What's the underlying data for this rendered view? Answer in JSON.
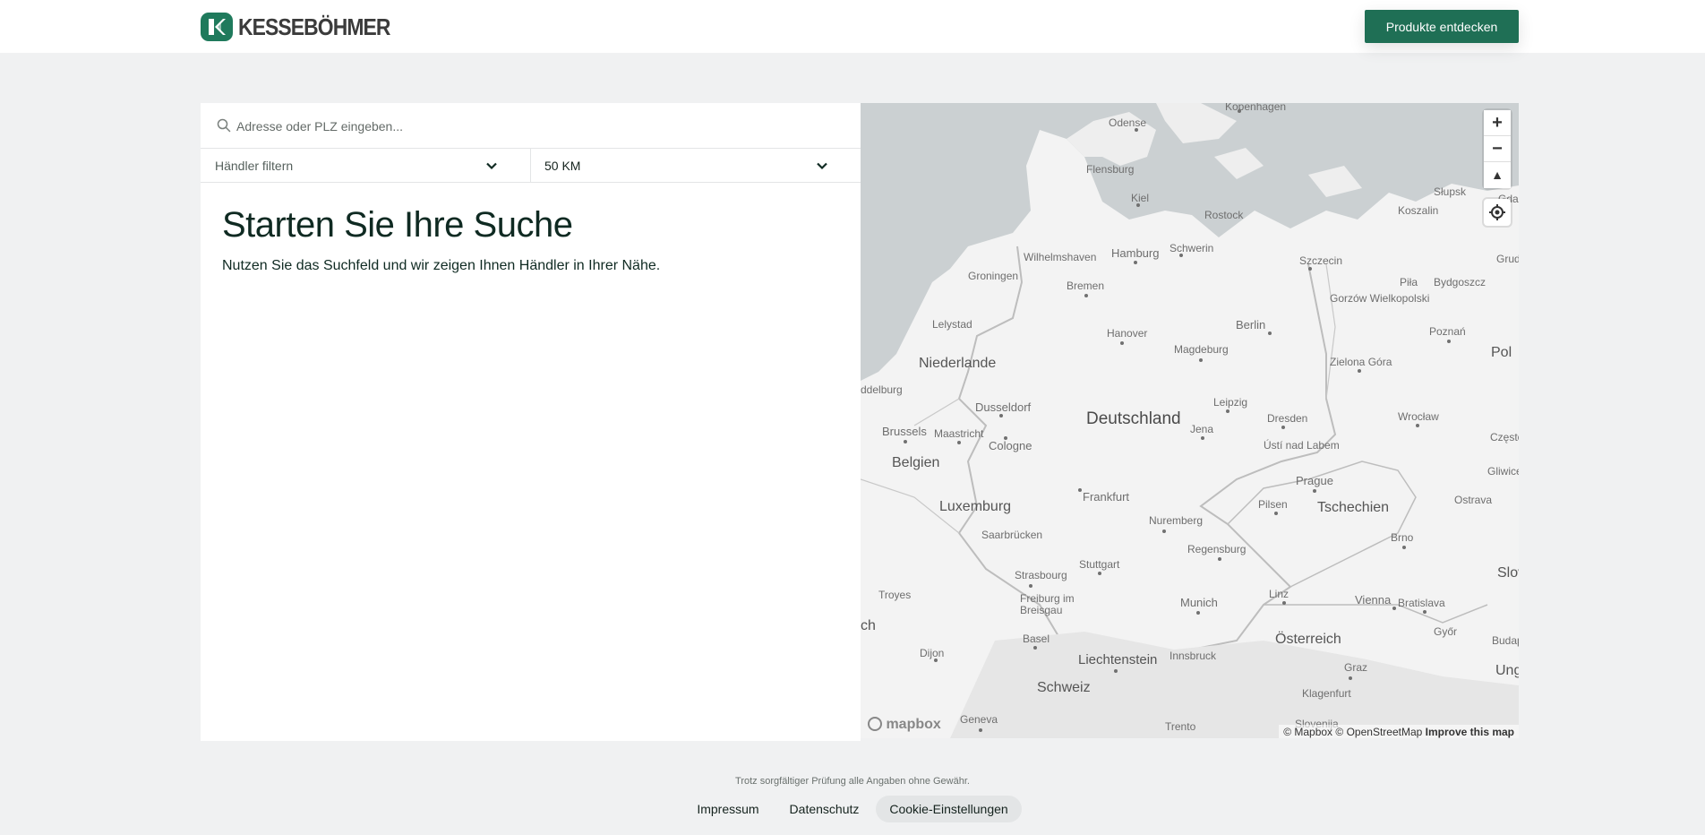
{
  "header": {
    "brand": "KESSEBÖHMER",
    "cta_label": "Produkte entdecken",
    "brand_color": "#1f7a5c"
  },
  "search": {
    "placeholder": "Adresse oder PLZ eingeben...",
    "icon": "search-icon"
  },
  "filters": {
    "dealer_label": "Händler filtern",
    "radius_value": "50 KM"
  },
  "main": {
    "heading": "Starten Sie Ihre Suche",
    "subtext": "Nutzen Sie das Suchfeld und wir zeigen Ihnen Händler in Ihrer Nähe."
  },
  "map": {
    "labels": {
      "kopenhagen": "Kopenhagen",
      "odense": "Odense",
      "flensburg": "Flensburg",
      "kiel": "Kiel",
      "rostock": "Rostock",
      "hamburg": "Hamburg",
      "schwerin": "Schwerin",
      "szczecin": "Szczecin",
      "koszalin": "Koszalin",
      "slupsk": "Słupsk",
      "gdansk": "Gdańsk",
      "grudziadz": "Grudziądz",
      "bydgoszcz": "Bydgoszcz",
      "wilhelmshaven": "Wilhelmshaven",
      "groningen": "Groningen",
      "bremen": "Bremen",
      "gorzow": "Gorzów Wielkopolski",
      "pila": "Piła",
      "poznan": "Poznań",
      "lelystad": "Lelystad",
      "berlin": "Berlin",
      "hanover": "Hanover",
      "magdeburg": "Magdeburg",
      "niederlande": "Niederlande",
      "zielona": "Zielona Góra",
      "pol": "Pol",
      "middelburg": "ddelburg",
      "deutschland": "Deutschland",
      "dusseldorf": "Dusseldorf",
      "leipzig": "Leipzig",
      "dresden": "Dresden",
      "wroclaw": "Wrocław",
      "brussels": "Brussels",
      "maastricht": "Maastricht",
      "cologne": "Cologne",
      "jena": "Jena",
      "ustinad": "Ústí nad Labem",
      "czestochowa": "Częstocho",
      "belgien": "Belgien",
      "prague": "Prague",
      "gliwice": "Gliwice",
      "frankfurt": "Frankfurt",
      "pilsen": "Pilsen",
      "tschechien": "Tschechien",
      "ostrava": "Ostrava",
      "luxemburg": "Luxemburg",
      "nuremberg": "Nuremberg",
      "brno": "Brno",
      "saarbrucken": "Saarbrücken",
      "regensburg": "Regensburg",
      "strasbourg": "Strasbourg",
      "stuttgart": "Stuttgart",
      "slov": "Slov",
      "troyes": "Troyes",
      "freiburg": "Freiburg im Breisgau",
      "munich": "Munich",
      "linz": "Linz",
      "vienna": "Vienna",
      "bratislava": "Bratislava",
      "ch": "ch",
      "gyor": "Győr",
      "basel": "Basel",
      "osterreich": "Österreich",
      "budape": "Budape",
      "dijon": "Dijon",
      "liechtenstein": "Liechtenstein",
      "innsbruck": "Innsbruck",
      "graz": "Graz",
      "ung": "Ung",
      "schweiz": "Schweiz",
      "klagenfurt": "Klagenfurt",
      "geneva": "Geneva",
      "trento": "Trento",
      "slovenija": "Slovenija"
    },
    "zoom_in": "+",
    "zoom_out": "−",
    "compass": "▲",
    "mapbox_logo": "mapbox",
    "attribution_mapbox": "© Mapbox",
    "attribution_osm": "© OpenStreetMap",
    "improve": "Improve this map"
  },
  "footer": {
    "disclaimer": "Trotz sorgfältiger Prüfung alle Angaben ohne Gewähr.",
    "impressum": "Impressum",
    "datenschutz": "Datenschutz",
    "cookies": "Cookie-Einstellungen"
  }
}
